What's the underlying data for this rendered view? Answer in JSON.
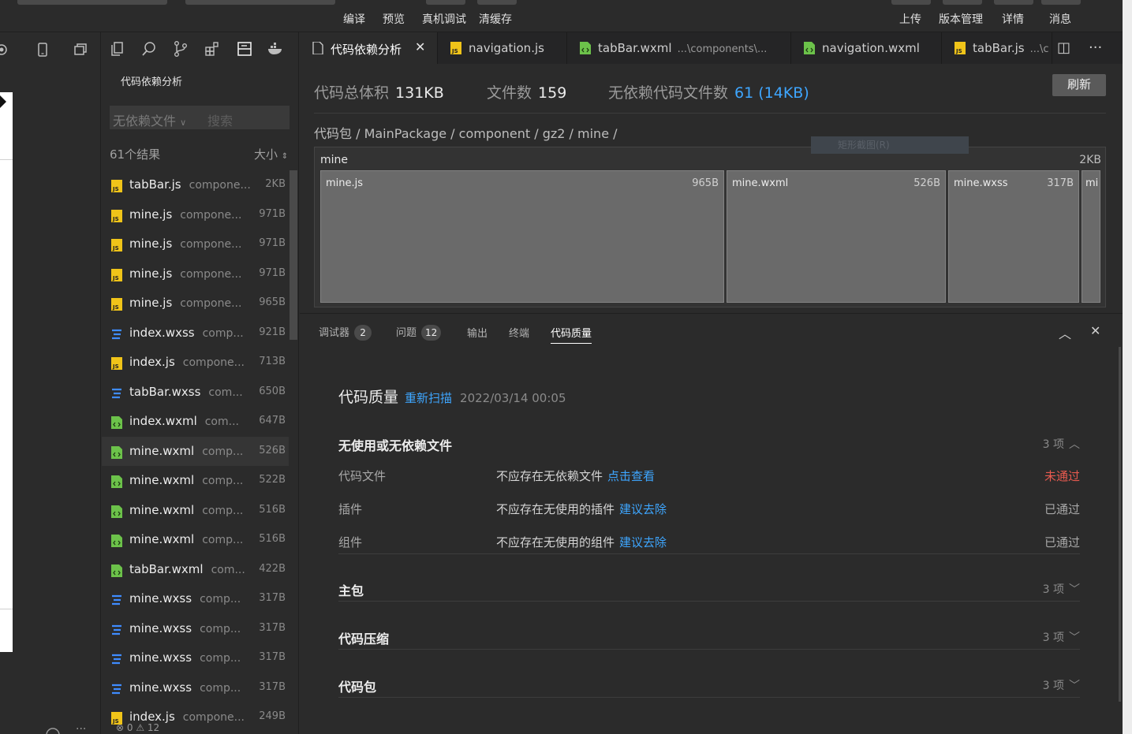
{
  "topbar": {
    "actions_left": [
      "编译",
      "预览",
      "真机调试",
      "清缓存"
    ],
    "actions_right": [
      "上传",
      "版本管理",
      "详情",
      "消息"
    ]
  },
  "file_panel": {
    "title": "代码依赖分析",
    "filter_select": "无依赖文件",
    "search_placeholder": "搜索",
    "result_count": "61个结果",
    "sort_label": "大小",
    "bottom_status": "⊗ 0 ⚠ 12",
    "files": [
      {
        "name": "tabBar.js",
        "path": "compone...",
        "size": "2KB",
        "type": "js"
      },
      {
        "name": "mine.js",
        "path": "compone...",
        "size": "971B",
        "type": "js"
      },
      {
        "name": "mine.js",
        "path": "compone...",
        "size": "971B",
        "type": "js"
      },
      {
        "name": "mine.js",
        "path": "compone...",
        "size": "971B",
        "type": "js"
      },
      {
        "name": "mine.js",
        "path": "compone...",
        "size": "965B",
        "type": "js"
      },
      {
        "name": "index.wxss",
        "path": "comp...",
        "size": "921B",
        "type": "wxss"
      },
      {
        "name": "index.js",
        "path": "compone...",
        "size": "713B",
        "type": "js"
      },
      {
        "name": "tabBar.wxss",
        "path": "com...",
        "size": "650B",
        "type": "wxss"
      },
      {
        "name": "index.wxml",
        "path": "com...",
        "size": "647B",
        "type": "wxml"
      },
      {
        "name": "mine.wxml",
        "path": "comp...",
        "size": "526B",
        "type": "wxml"
      },
      {
        "name": "mine.wxml",
        "path": "comp...",
        "size": "522B",
        "type": "wxml"
      },
      {
        "name": "mine.wxml",
        "path": "comp...",
        "size": "516B",
        "type": "wxml"
      },
      {
        "name": "mine.wxml",
        "path": "comp...",
        "size": "516B",
        "type": "wxml"
      },
      {
        "name": "tabBar.wxml",
        "path": "com...",
        "size": "422B",
        "type": "wxml"
      },
      {
        "name": "mine.wxss",
        "path": "comp...",
        "size": "317B",
        "type": "wxss"
      },
      {
        "name": "mine.wxss",
        "path": "comp...",
        "size": "317B",
        "type": "wxss"
      },
      {
        "name": "mine.wxss",
        "path": "comp...",
        "size": "317B",
        "type": "wxss"
      },
      {
        "name": "mine.wxss",
        "path": "comp...",
        "size": "317B",
        "type": "wxss"
      },
      {
        "name": "index.js",
        "path": "compone...",
        "size": "249B",
        "type": "js"
      }
    ]
  },
  "tabs": [
    {
      "label": "代码依赖分析",
      "path": "",
      "type": "analysis",
      "active": true
    },
    {
      "label": "navigation.js",
      "path": "",
      "type": "js",
      "active": false
    },
    {
      "label": "tabBar.wxml",
      "path": "...\\components\\...",
      "type": "wxml",
      "active": false
    },
    {
      "label": "navigation.wxml",
      "path": "",
      "type": "wxml",
      "active": false
    },
    {
      "label": "tabBar.js",
      "path": "...\\c",
      "type": "js",
      "active": false
    }
  ],
  "analysis": {
    "total_size_label": "代码总体积",
    "total_size": "131KB",
    "file_count_label": "文件数",
    "file_count": "159",
    "unused_label": "无依赖代码文件数",
    "unused_value": "61 (14KB)",
    "refresh_label": "刷新",
    "breadcrumb": "代码包 / MainPackage / component / gz2 / mine /",
    "ghost_tip": "矩形截图(R)",
    "treemap": {
      "title": "mine",
      "size": "2KB",
      "cells": [
        {
          "name": "mine.js",
          "size": "965B"
        },
        {
          "name": "mine.wxml",
          "size": "526B"
        },
        {
          "name": "mine.wxss",
          "size": "317B"
        },
        {
          "name": "mi",
          "size": ""
        }
      ]
    }
  },
  "panel": {
    "tabs": [
      {
        "label": "调试器",
        "badge": "2"
      },
      {
        "label": "问题",
        "badge": "12"
      },
      {
        "label": "输出",
        "badge": ""
      },
      {
        "label": "终端",
        "badge": ""
      },
      {
        "label": "代码质量",
        "badge": ""
      }
    ],
    "quality": {
      "title": "代码质量",
      "rescan": "重新扫描",
      "date": "2022/03/14 00:05",
      "sections": [
        {
          "title": "无使用或无依赖文件",
          "count": "3 项",
          "expanded": true,
          "rules": [
            {
              "category": "代码文件",
              "desc": "不应存在无依赖文件",
              "link": "点击查看",
              "status": "未通过",
              "fail": true
            },
            {
              "category": "插件",
              "desc": "不应存在无使用的插件",
              "link": "建议去除",
              "status": "已通过",
              "fail": false
            },
            {
              "category": "组件",
              "desc": "不应存在无使用的组件",
              "link": "建议去除",
              "status": "已通过",
              "fail": false
            }
          ]
        },
        {
          "title": "主包",
          "count": "3 项",
          "expanded": false,
          "rules": []
        },
        {
          "title": "代码压缩",
          "count": "3 项",
          "expanded": false,
          "rules": []
        },
        {
          "title": "代码包",
          "count": "3 项",
          "expanded": false,
          "rules": []
        }
      ]
    }
  },
  "colors": {
    "accent": "#3ea6ff",
    "fail": "#e85a4f",
    "js_icon": "#f0c419",
    "wxml_icon": "#6cc24a",
    "wxss_icon": "#3f8cff"
  }
}
